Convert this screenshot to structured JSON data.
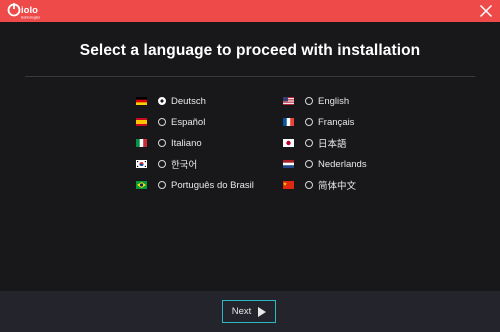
{
  "header": {
    "logo_text": "iolo",
    "logo_tagline": "technologies"
  },
  "title": "Select a language to proceed with installation",
  "languages_left": [
    {
      "label": "Deutsch",
      "flag": "de",
      "selected": true
    },
    {
      "label": "Español",
      "flag": "es",
      "selected": false
    },
    {
      "label": "Italiano",
      "flag": "it",
      "selected": false
    },
    {
      "label": "한국어",
      "flag": "kr",
      "selected": false
    },
    {
      "label": "Português do Brasil",
      "flag": "br",
      "selected": false
    }
  ],
  "languages_right": [
    {
      "label": "English",
      "flag": "us",
      "selected": false
    },
    {
      "label": "Français",
      "flag": "fr",
      "selected": false
    },
    {
      "label": "日本語",
      "flag": "jp",
      "selected": false
    },
    {
      "label": "Nederlands",
      "flag": "nl",
      "selected": false
    },
    {
      "label": "简体中文",
      "flag": "cn",
      "selected": false
    }
  ],
  "footer": {
    "next_label": "Next"
  },
  "colors": {
    "titlebar": "#ee4a4a",
    "background": "#18181b",
    "footer": "#24242c",
    "accent": "#2fb8c4"
  }
}
